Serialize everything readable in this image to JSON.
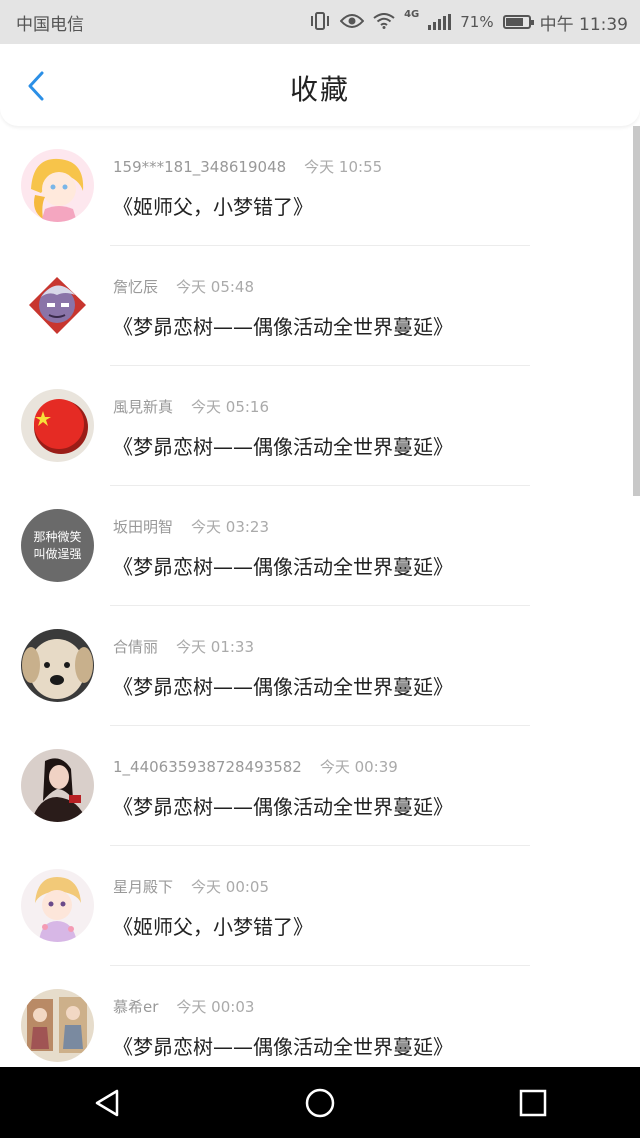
{
  "status_bar": {
    "carrier": "中国电信",
    "network": "4G",
    "battery": "71%",
    "battery_level": 0.71,
    "time": "中午 11:39"
  },
  "header": {
    "title": "收藏",
    "back_icon": "chevron-left-icon",
    "accent_color": "#2b8fe6"
  },
  "favorites": [
    {
      "user": "159***181_348619048",
      "time": "今天 10:55",
      "title": "《姬师父，小梦错了》"
    },
    {
      "user": "詹忆辰",
      "time": "今天 05:48",
      "title": "《梦昴恋树——偶像活动全世界蔓延》"
    },
    {
      "user": "風見新真",
      "time": "今天 05:16",
      "title": "《梦昴恋树——偶像活动全世界蔓延》"
    },
    {
      "user": "坂田明智",
      "time": "今天 03:23",
      "title": "《梦昴恋树——偶像活动全世界蔓延》",
      "avatar_text": "那种微笑叫做逞强"
    },
    {
      "user": "合倩丽",
      "time": "今天 01:33",
      "title": "《梦昴恋树——偶像活动全世界蔓延》"
    },
    {
      "user": "1_440635938728493582",
      "time": "今天 00:39",
      "title": "《梦昴恋树——偶像活动全世界蔓延》"
    },
    {
      "user": "星月殿下",
      "time": "今天 00:05",
      "title": "《姬师父，小梦错了》"
    },
    {
      "user": "慕希er",
      "time": "今天 00:03",
      "title": "《梦昴恋树——偶像活动全世界蔓延》"
    }
  ],
  "nav_bar": {
    "back": "triangle-back-icon",
    "home": "circle-home-icon",
    "recents": "square-recents-icon"
  }
}
